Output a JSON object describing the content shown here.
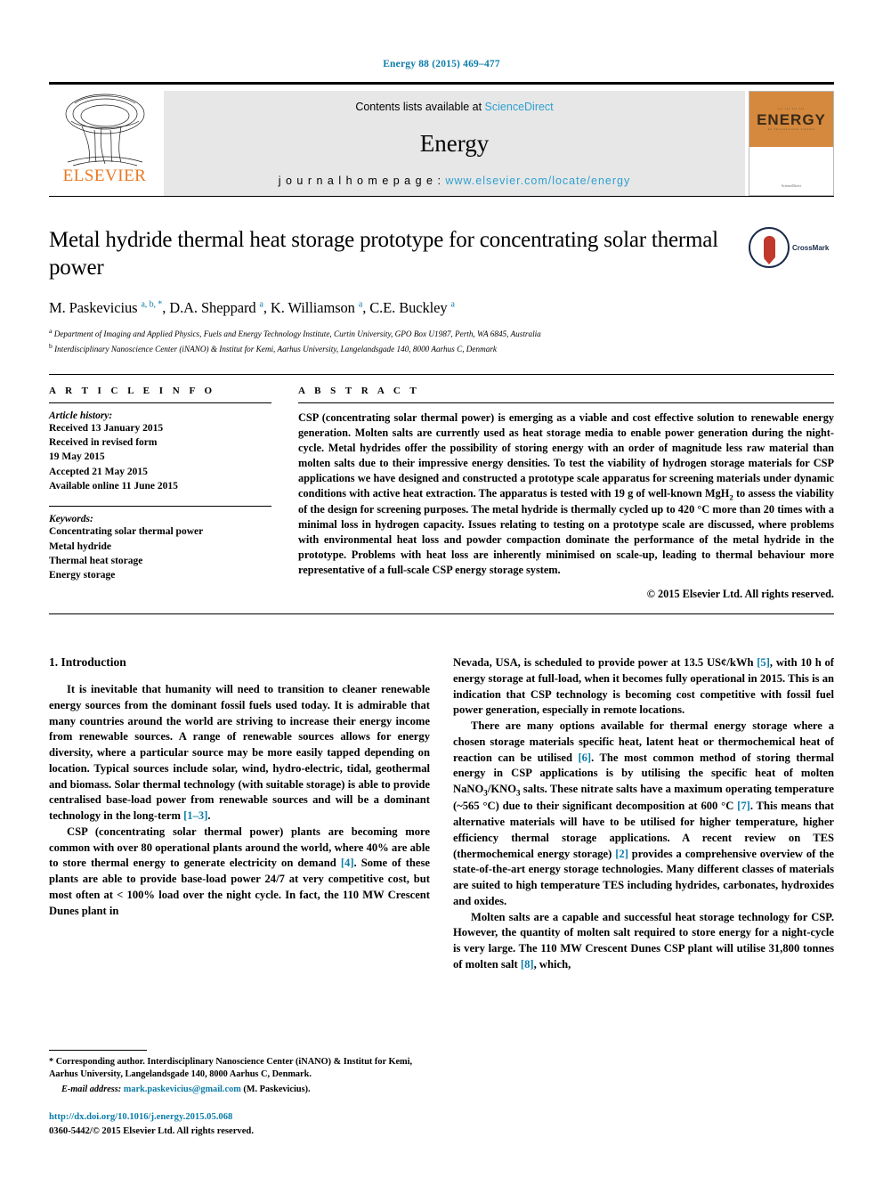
{
  "running_head": "Energy 88 (2015) 469–477",
  "masthead": {
    "contents_prefix": "Contents lists available at ",
    "sciencedirect": "ScienceDirect",
    "journal_name": "Energy",
    "homepage_prefix": "j o u r n a l   h o m e p a g e :   ",
    "homepage_url": "www.elsevier.com/locate/energy",
    "publisher": "ELSEVIER",
    "cover_title": "ENERGY",
    "cover_sub": "An International Journal",
    "cover_footer": "ScienceDirect"
  },
  "title": "Metal hydride thermal heat storage prototype for concentrating solar thermal power",
  "crossmark_label": "CrossMark",
  "authors_html": "M. Paskevicius <sup>a, b, *</sup>, D.A. Sheppard <sup>a</sup>, K. Williamson <sup>a</sup>, C.E. Buckley <sup>a</sup>",
  "affiliations": [
    "a Department of Imaging and Applied Physics, Fuels and Energy Technology Institute, Curtin University, GPO Box U1987, Perth, WA 6845, Australia",
    "b Interdisciplinary Nanoscience Center (iNANO) & Institut for Kemi, Aarhus University, Langelandsgade 140, 8000 Aarhus C, Denmark"
  ],
  "article_info": {
    "heading": "A R T I C L E  I N F O",
    "history_title": "Article history:",
    "history": [
      "Received 13 January 2015",
      "Received in revised form",
      "19 May 2015",
      "Accepted 21 May 2015",
      "Available online 11 June 2015"
    ],
    "keywords_title": "Keywords:",
    "keywords": [
      "Concentrating solar thermal power",
      "Metal hydride",
      "Thermal heat storage",
      "Energy storage"
    ]
  },
  "abstract": {
    "heading": "A B S T R A C T",
    "text": "CSP (concentrating solar thermal power) is emerging as a viable and cost effective solution to renewable energy generation. Molten salts are currently used as heat storage media to enable power generation during the night-cycle. Metal hydrides offer the possibility of storing energy with an order of magnitude less raw material than molten salts due to their impressive energy densities. To test the viability of hydrogen storage materials for CSP applications we have designed and constructed a prototype scale apparatus for screening materials under dynamic conditions with active heat extraction. The apparatus is tested with 19 g of well-known MgH2 to assess the viability of the design for screening purposes. The metal hydride is thermally cycled up to 420 °C more than 20 times with a minimal loss in hydrogen capacity. Issues relating to testing on a prototype scale are discussed, where problems with environmental heat loss and powder compaction dominate the performance of the metal hydride in the prototype. Problems with heat loss are inherently minimised on scale-up, leading to thermal behaviour more representative of a full-scale CSP energy storage system.",
    "copyright": "© 2015 Elsevier Ltd. All rights reserved."
  },
  "body": {
    "section_heading": "1. Introduction",
    "left_paragraphs": [
      "It is inevitable that humanity will need to transition to cleaner renewable energy sources from the dominant fossil fuels used today. It is admirable that many countries around the world are striving to increase their energy income from renewable sources. A range of renewable sources allows for energy diversity, where a particular source may be more easily tapped depending on location. Typical sources include solar, wind, hydro-electric, tidal, geothermal and biomass. Solar thermal technology (with suitable storage) is able to provide centralised base-load power from renewable sources and will be a dominant technology in the long-term [1–3].",
      "CSP (concentrating solar thermal power) plants are becoming more common with over 80 operational plants around the world, where 40% are able to store thermal energy to generate electricity on demand [4]. Some of these plants are able to provide base-load power 24/7 at very competitive cost, but most often at < 100% load over the night cycle. In fact, the 110 MW Crescent Dunes plant in"
    ],
    "right_paragraphs": [
      "Nevada, USA, is scheduled to provide power at 13.5 US¢/kWh [5], with 10 h of energy storage at full-load, when it becomes fully operational in 2015. This is an indication that CSP technology is becoming cost competitive with fossil fuel power generation, especially in remote locations.",
      "There are many options available for thermal energy storage where a chosen storage materials specific heat, latent heat or thermochemical heat of reaction can be utilised [6]. The most common method of storing thermal energy in CSP applications is by utilising the specific heat of molten NaNO3/KNO3 salts. These nitrate salts have a maximum operating temperature (~565 °C) due to their significant decomposition at 600 °C [7]. This means that alternative materials will have to be utilised for higher temperature, higher efficiency thermal storage applications. A recent review on TES (thermochemical energy storage) [2] provides a comprehensive overview of the state-of-the-art energy storage technologies. Many different classes of materials are suited to high temperature TES including hydrides, carbonates, hydroxides and oxides.",
      "Molten salts are a capable and successful heat storage technology for CSP. However, the quantity of molten salt required to store energy for a night-cycle is very large. The 110 MW Crescent Dunes CSP plant will utilise 31,800 tonnes of molten salt [8], which,"
    ]
  },
  "footnotes": {
    "corresponding": "* Corresponding author. Interdisciplinary Nanoscience Center (iNANO) & Institut for Kemi, Aarhus University, Langelandsgade 140, 8000 Aarhus C, Denmark.",
    "email_label": "E-mail address:",
    "email": "mark.paskevicius@gmail.com",
    "email_suffix": "(M. Paskevicius).",
    "doi": "http://dx.doi.org/10.1016/j.energy.2015.05.068",
    "issn_line": "0360-5442/© 2015 Elsevier Ltd. All rights reserved."
  },
  "colors": {
    "link": "#0b7ca8",
    "elsevier_orange": "#e87722",
    "sciencedirect": "#2f9fd0"
  }
}
